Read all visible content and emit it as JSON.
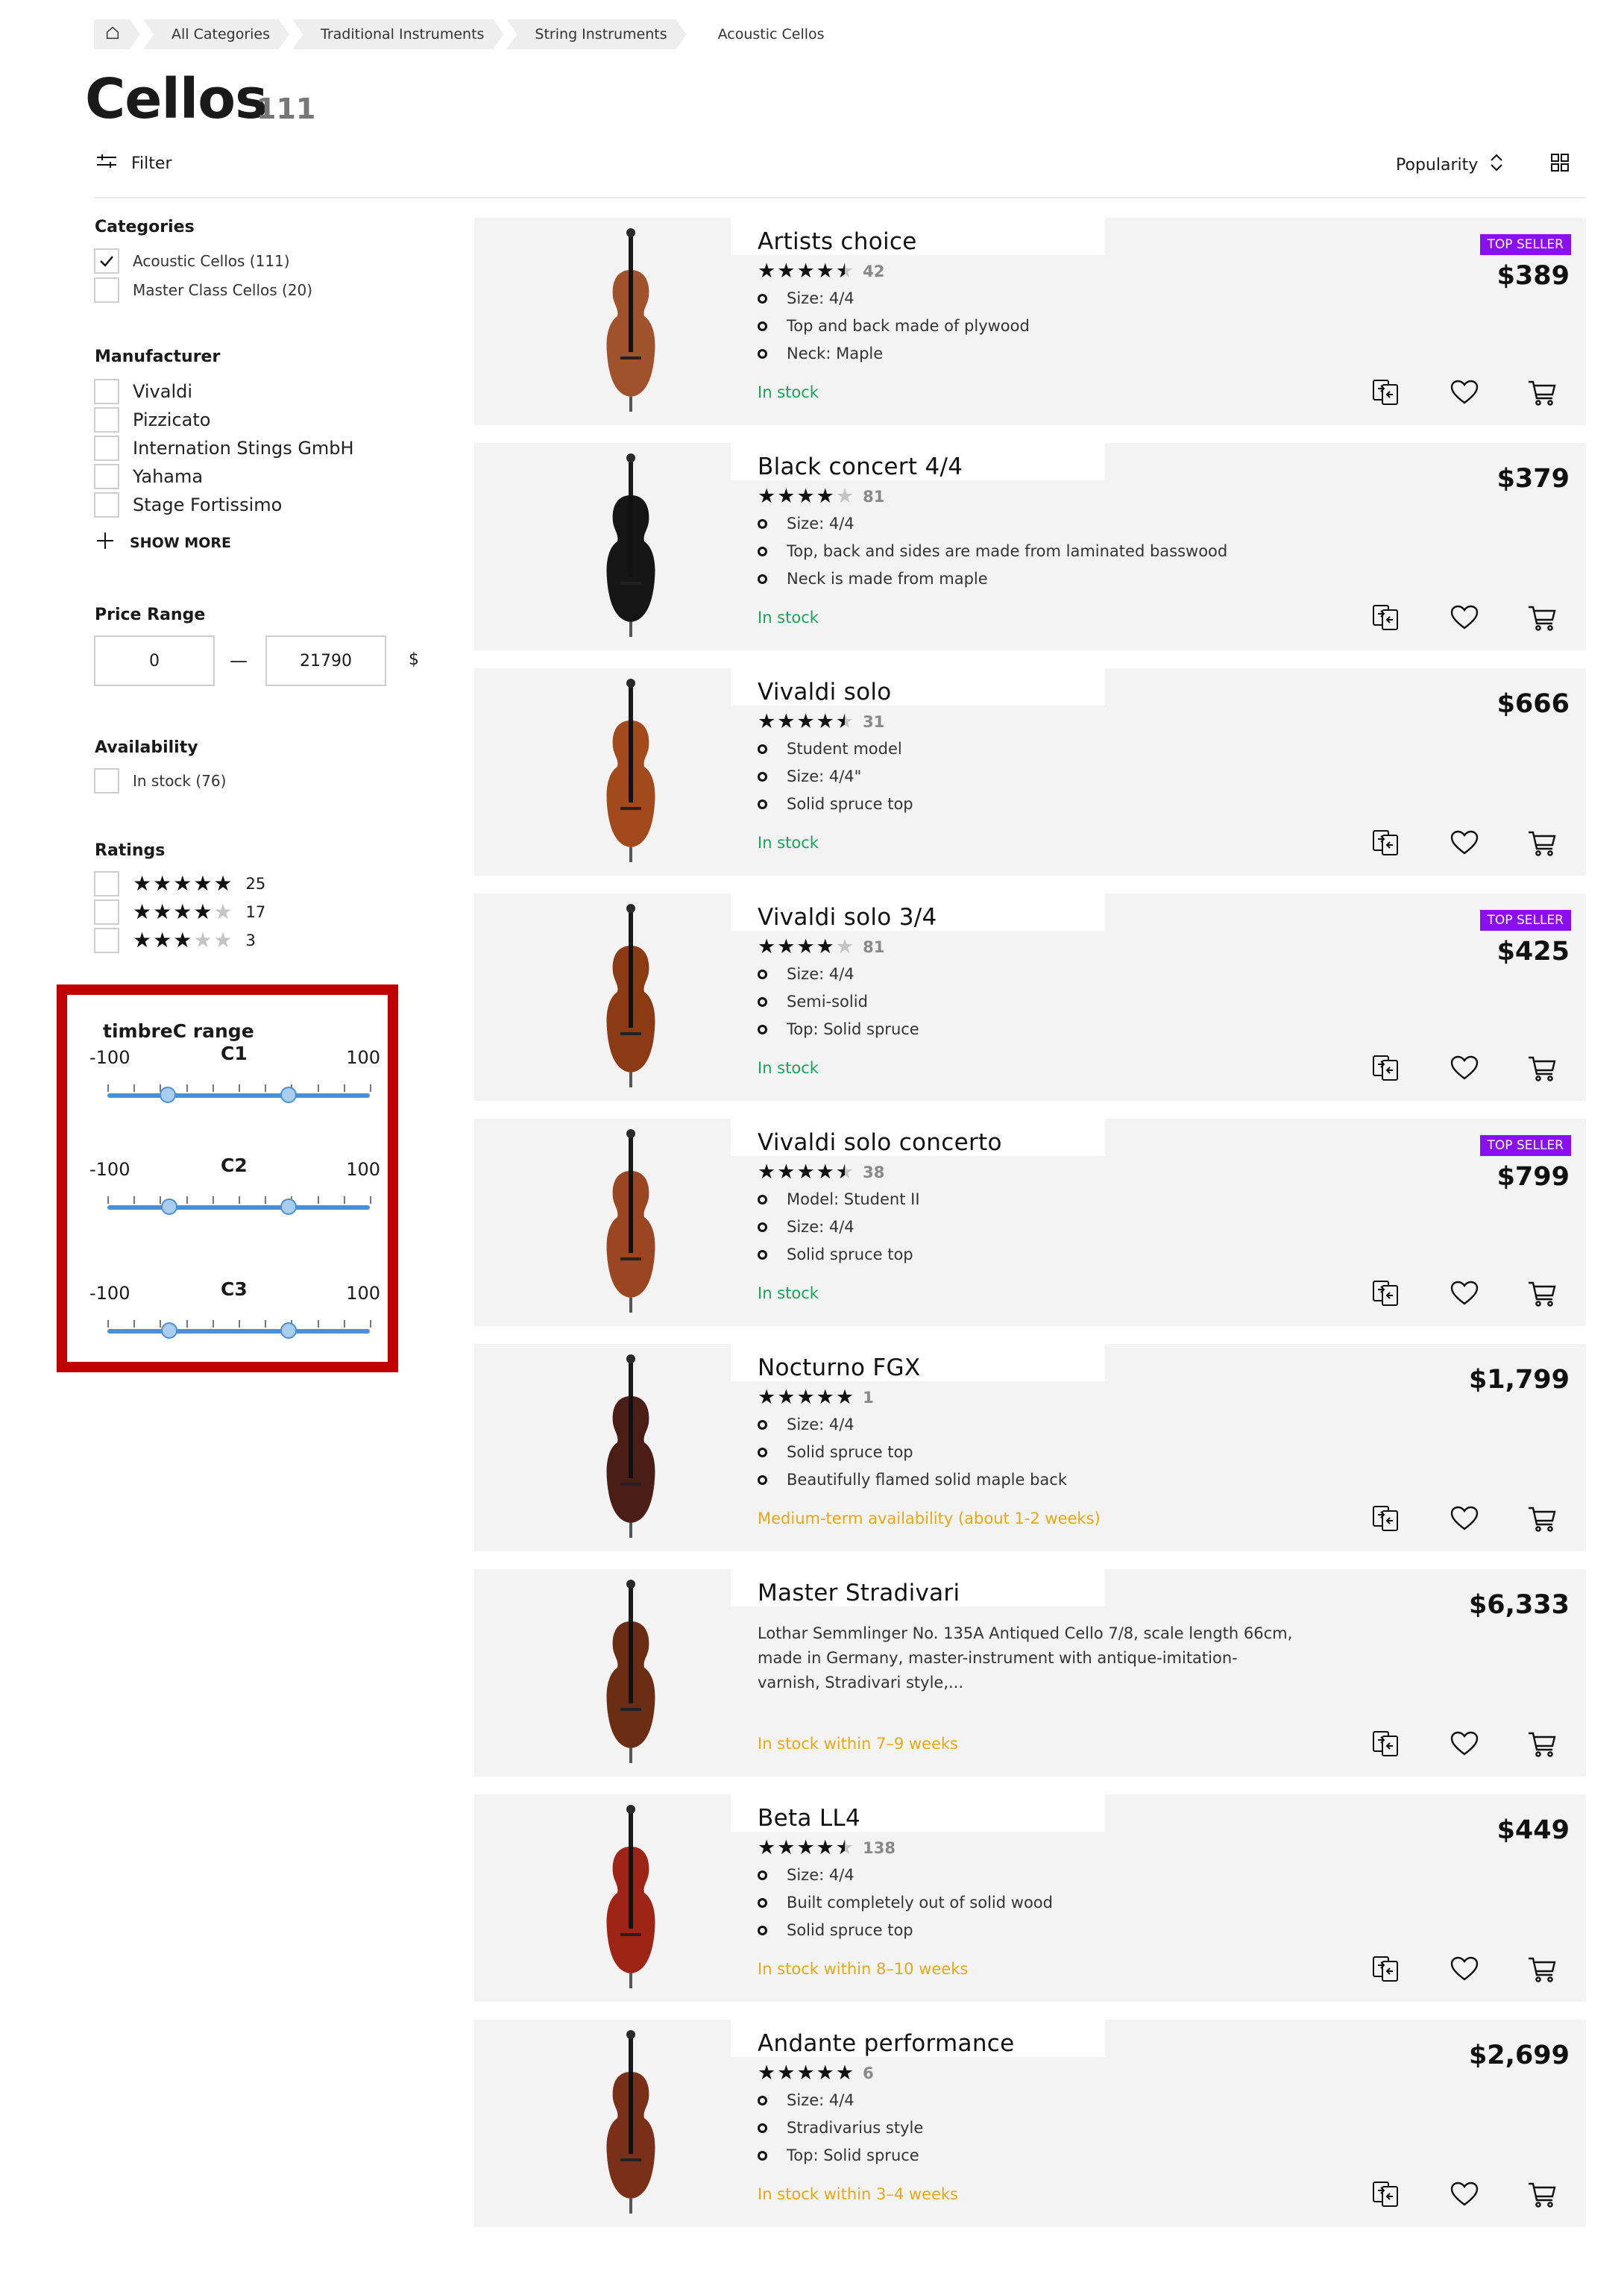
{
  "breadcrumb": [
    "All Categories",
    "Traditional Instruments",
    "String Instruments",
    "Acoustic Cellos"
  ],
  "page": {
    "title": "Cellos",
    "count": "111"
  },
  "toolbar": {
    "filter_label": "Filter",
    "sort_label": "Popularity"
  },
  "sidebar": {
    "categories_heading": "Categories",
    "categories": [
      "Acoustic Cellos (111)",
      "Master Class Cellos (20)"
    ],
    "manufacturer_heading": "Manufacturer",
    "manufacturers": [
      "Vivaldi",
      "Pizzicato",
      "Internation Stings GmbH",
      "Yahama",
      "Stage Fortissimo"
    ],
    "show_more": "SHOW MORE",
    "price_heading": "Price Range",
    "price_min": "0",
    "price_max": "21790",
    "price_unit": "$",
    "availability_heading": "Availability",
    "availability_option": "In stock (76)",
    "ratings_heading": "Ratings",
    "ratings": [
      {
        "stars": 5,
        "count": "25"
      },
      {
        "stars": 4,
        "count": "17"
      },
      {
        "stars": 3,
        "count": "3"
      }
    ]
  },
  "timbre": {
    "title": "timbreC range",
    "sliders": [
      {
        "name": "C1",
        "min": "-100",
        "max": "100",
        "low": -54,
        "high": 38
      },
      {
        "name": "C2",
        "min": "-100",
        "max": "100",
        "low": -53,
        "high": 38
      },
      {
        "name": "C3",
        "min": "-100",
        "max": "100",
        "low": -53,
        "high": 38
      }
    ]
  },
  "products": [
    {
      "name": "Artists choice",
      "rating": 4.5,
      "reviews": "42",
      "features": [
        "Size: 4/4",
        "Top and back made of plywood",
        "Neck: Maple"
      ],
      "availability": "In stock",
      "avail_color": "green",
      "price": "$389",
      "badge": "TOP SELLER",
      "body_color": "#a0522d"
    },
    {
      "name": "Black  concert 4/4",
      "rating": 4,
      "reviews": "81",
      "features": [
        "Size: 4/4",
        "Top, back and sides are made from laminated basswood",
        "Neck is made from maple"
      ],
      "availability": "In stock",
      "avail_color": "green",
      "price": "$379",
      "badge": "",
      "body_color": "#151515"
    },
    {
      "name": "Vivaldi solo",
      "rating": 4.5,
      "reviews": "31",
      "features": [
        "Student model",
        "Size: 4/4\"",
        "Solid spruce top"
      ],
      "availability": "In stock",
      "avail_color": "green",
      "price": "$666",
      "badge": "",
      "body_color": "#a24a1c"
    },
    {
      "name": "Vivaldi solo 3/4",
      "rating": 4,
      "reviews": "81",
      "features": [
        "Size: 4/4",
        "Semi-solid",
        "Top: Solid spruce"
      ],
      "availability": "In stock",
      "avail_color": "green",
      "price": "$425",
      "badge": "TOP SELLER",
      "body_color": "#8b3a14"
    },
    {
      "name": "Vivaldi solo concerto",
      "rating": 4.5,
      "reviews": "38",
      "features": [
        "Model: Student II",
        "Size: 4/4",
        "Solid spruce top"
      ],
      "availability": "In stock",
      "avail_color": "green",
      "price": "$799",
      "badge": "TOP SELLER",
      "body_color": "#9a4622"
    },
    {
      "name": "Nocturno FGX",
      "rating": 5,
      "reviews": "1",
      "features": [
        "Size: 4/4",
        "Solid spruce top",
        "Beautifully flamed solid maple back"
      ],
      "availability": "Medium-term availability (about 1-2 weeks)",
      "avail_color": "amber",
      "price": "$1,799",
      "badge": "",
      "body_color": "#4a1e16"
    },
    {
      "name": "Master Stradivari",
      "rating": 0,
      "reviews": "",
      "features": [],
      "description": "Lothar Semmlinger No. 135A Antiqued Cello 7/8, scale length 66cm, made in Germany, master-instrument with antique-imitation-varnish, Stradivari style,...",
      "availability": "In stock within 7–9 weeks",
      "avail_color": "amber",
      "price": "$6,333",
      "badge": "",
      "body_color": "#6b2d14"
    },
    {
      "name": "Beta LL4",
      "rating": 4.5,
      "reviews": "138",
      "features": [
        "Size: 4/4",
        "Built completely out of solid wood",
        "Solid spruce top"
      ],
      "availability": "In stock within 8–10 weeks",
      "avail_color": "amber",
      "price": "$449",
      "badge": "",
      "body_color": "#9e2516"
    },
    {
      "name": "Andante performance",
      "rating": 5,
      "reviews": "6",
      "features": [
        "Size: 4/4",
        "Stradivarius style",
        "Top: Solid spruce"
      ],
      "availability": "In stock within 3–4 weeks",
      "avail_color": "amber",
      "price": "$2,699",
      "badge": "",
      "body_color": "#7a3018"
    }
  ],
  "colors": {
    "in_stock": "#1aa25c",
    "delayed": "#e6a817",
    "badge": "#8a0ff0",
    "highlight_border": "#c00000",
    "slider": "#4a90d9"
  }
}
